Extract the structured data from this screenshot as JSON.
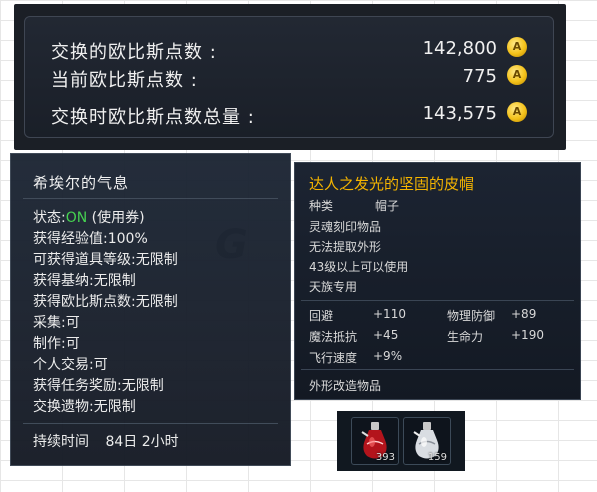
{
  "points": {
    "rows": [
      {
        "label": "交换的欧比斯点数 :",
        "value": "142,800"
      },
      {
        "label": "当前欧比斯点数 :",
        "value": "775"
      },
      {
        "label": "交换时欧比斯点数总量 :",
        "value": "143,575"
      }
    ],
    "coin_icon": "gold-coin-icon",
    "coin_letter": "A"
  },
  "buff": {
    "title": "希埃尔的气息",
    "status_prefix": "状态:",
    "status_on": "ON",
    "status_suffix": " (使用券)",
    "lines": [
      "获得经验值:100%",
      "可获得道具等级:无限制",
      "获得基纳:无限制",
      "获得欧比斯点数:无限制",
      "采集:可",
      "制作:可",
      "个人交易:可",
      "获得任务奖励:无限制",
      "交换遗物:无限制"
    ],
    "duration_label": "持续时间",
    "duration_value": "84日 2小时"
  },
  "item": {
    "title": "达人之发光的坚固的皮帽",
    "type_label": "种类",
    "type_value": "帽子",
    "info_lines": [
      "灵魂刻印物品",
      "无法提取外形",
      "43级以上可以使用",
      "天族专用"
    ],
    "stats": [
      {
        "name": "回避",
        "value": "+110"
      },
      {
        "name": "物理防御",
        "value": "+89"
      },
      {
        "name": "魔法抵抗",
        "value": "+45"
      },
      {
        "name": "生命力",
        "value": "+190"
      },
      {
        "name": "飞行速度",
        "value": "+9%"
      }
    ],
    "footer": "外形改造物品"
  },
  "slots": [
    {
      "icon": "red-potion-icon",
      "count": "393"
    },
    {
      "icon": "white-potion-icon",
      "count": "159"
    }
  ],
  "colors": {
    "item_title": "#f4b400",
    "status_on": "#3fd14a",
    "coin": "#f4c21a"
  },
  "watermark": "G"
}
